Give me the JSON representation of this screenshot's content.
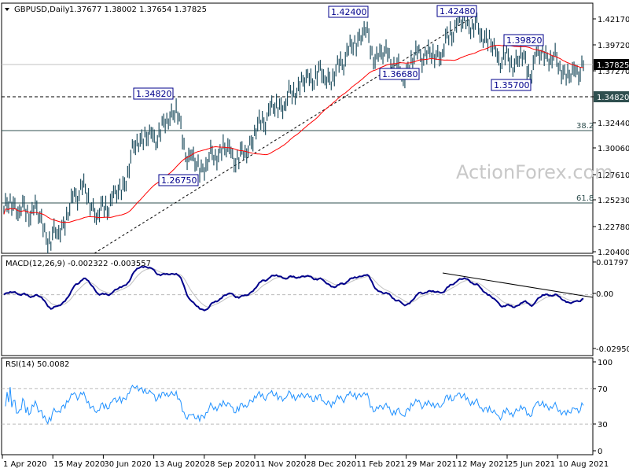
{
  "header": {
    "symbol": "GBPUSD,Daily",
    "ohlc": "1.37677 1.38002 1.37654 1.37825"
  },
  "watermark": "ActionForex.com",
  "chart_data": [
    {
      "type": "bar",
      "title": "GBPUSD,Daily",
      "ylim": [
        1.204,
        1.4217
      ],
      "y_ticks": [
        "1.42170",
        "1.39720",
        "1.37270",
        "1.34820",
        "1.32440",
        "1.30060",
        "1.27610",
        "1.25230",
        "1.22780",
        "1.20400"
      ],
      "x_ticks": [
        "1 Apr 2020",
        "15 May 2020",
        "30 Jun 2020",
        "13 Aug 2020",
        "28 Sep 2020",
        "11 Nov 2020",
        "28 Dec 2020",
        "11 Feb 2021",
        "29 Mar 2021",
        "12 May 2021",
        "25 Jun 2021",
        "10 Aug 2021"
      ],
      "weekly_close": [
        1.243,
        1.25,
        1.245,
        1.24,
        1.245,
        1.225,
        1.215,
        1.225,
        1.235,
        1.255,
        1.265,
        1.25,
        1.24,
        1.245,
        1.255,
        1.26,
        1.285,
        1.31,
        1.31,
        1.31,
        1.315,
        1.33,
        1.34,
        1.3,
        1.29,
        1.28,
        1.29,
        1.295,
        1.3,
        1.295,
        1.29,
        1.3,
        1.315,
        1.325,
        1.335,
        1.34,
        1.345,
        1.355,
        1.36,
        1.365,
        1.37,
        1.37,
        1.365,
        1.38,
        1.39,
        1.4,
        1.415,
        1.39,
        1.385,
        1.39,
        1.375,
        1.37,
        1.38,
        1.39,
        1.385,
        1.39,
        1.39,
        1.41,
        1.415,
        1.42,
        1.415,
        1.41,
        1.4,
        1.385,
        1.385,
        1.38,
        1.39,
        1.37,
        1.385,
        1.39,
        1.385,
        1.38,
        1.365,
        1.372,
        1.378
      ],
      "current_price": "1.37825",
      "support_level": "1.34820",
      "fib_levels": [
        {
          "label": "38.2",
          "value": 1.3173
        },
        {
          "label": "61.8",
          "value": 1.2496
        }
      ],
      "annotations": [
        "1.42400",
        "1.42480",
        "1.39820",
        "1.36680",
        "1.35700",
        "1.34820",
        "1.26750"
      ],
      "colors": {
        "bars": "#1f4e5f",
        "ma": "#ff0000",
        "current": "#000000",
        "support_box": "#2f4f4f"
      }
    },
    {
      "type": "line",
      "title": "MACD(12,26,9) -0.002322 -0.003557",
      "ylim": [
        -0.029505,
        0.017975
      ],
      "y_ticks": [
        "0.017975",
        "0.00",
        "-0.029505"
      ],
      "colors": {
        "macd": "#00008b",
        "signal": "#c0c0c0"
      }
    },
    {
      "type": "line",
      "title": "RSI(14) 50.0082",
      "ylim": [
        0,
        100
      ],
      "y_ticks": [
        "100",
        "70",
        "30",
        "0"
      ],
      "colors": {
        "rsi": "#1e90ff"
      }
    }
  ]
}
